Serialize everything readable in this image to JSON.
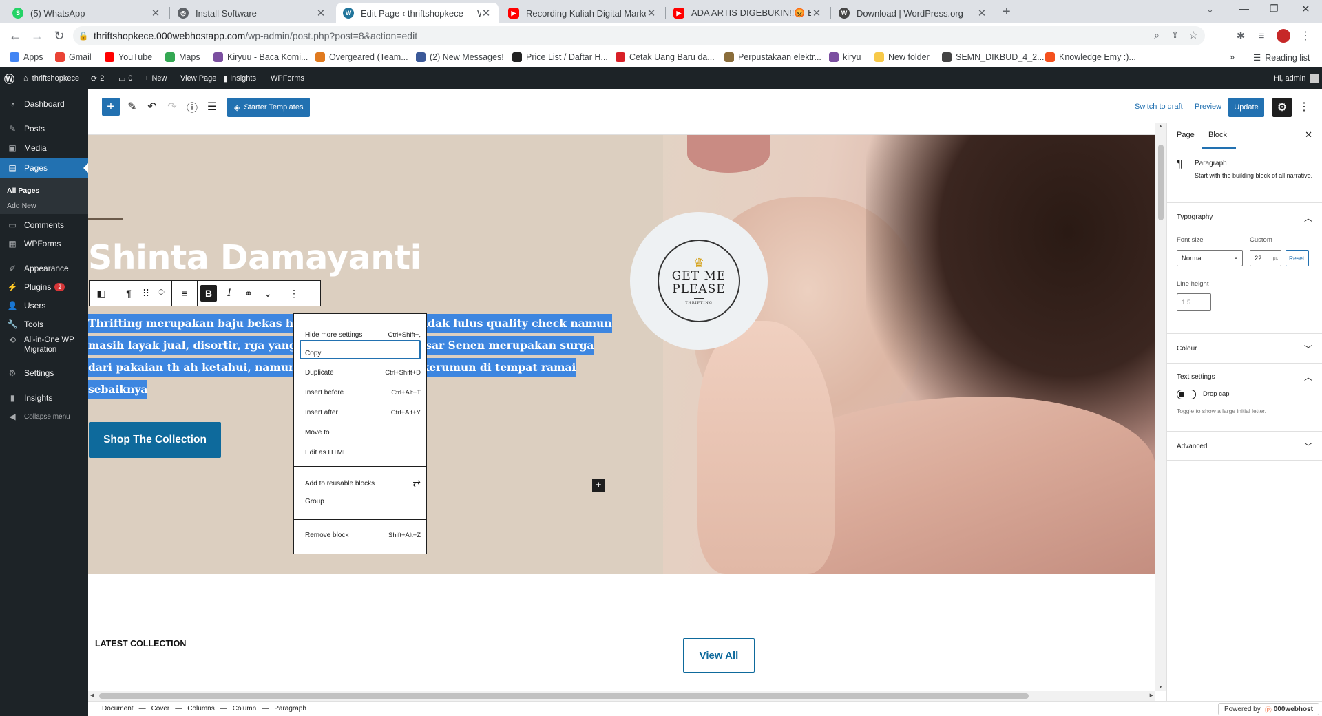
{
  "browser": {
    "tabs": [
      {
        "title": "(5) WhatsApp",
        "icon": "whatsapp-icon",
        "color": "#25d366"
      },
      {
        "title": "Install Software",
        "icon": "globe-icon",
        "color": "#5f6368"
      },
      {
        "title": "Edit Page ‹ thriftshopkece — Wo",
        "icon": "wordpress-icon",
        "color": "#21759b"
      },
      {
        "title": "Recording Kuliah Digital Marketin",
        "icon": "youtube-icon",
        "color": "#ff0000"
      },
      {
        "title": "ADA ARTIS DIGEBUKIN!!😡 ERICK",
        "icon": "youtube-icon",
        "color": "#ff0000"
      },
      {
        "title": "Download | WordPress.org",
        "icon": "wordpress-icon",
        "color": "#464646"
      }
    ],
    "url_host": "thriftshopkece.000webhostapp.com",
    "url_path": "/wp-admin/post.php?post=8&action=edit",
    "bookmarks": [
      {
        "label": "Apps",
        "color": "#4285f4"
      },
      {
        "label": "Gmail",
        "color": "#ea4335"
      },
      {
        "label": "YouTube",
        "color": "#ff0000"
      },
      {
        "label": "Maps",
        "color": "#34a853"
      },
      {
        "label": "Kiryuu - Baca Komi...",
        "color": "#7b4fa0"
      },
      {
        "label": "Overgeared (Team...",
        "color": "#e07a1f"
      },
      {
        "label": "(2) New Messages!",
        "color": "#3b5998"
      },
      {
        "label": "Price List / Daftar H...",
        "color": "#222222"
      },
      {
        "label": "Cetak Uang Baru da...",
        "color": "#d81f26"
      },
      {
        "label": "Perpustakaan elektr...",
        "color": "#8a6d3b"
      },
      {
        "label": "kiryu",
        "color": "#7b4fa0"
      },
      {
        "label": "New folder",
        "color": "#f7c948"
      },
      {
        "label": "SEMN_DIKBUD_4_2...",
        "color": "#444444"
      },
      {
        "label": "Knowledge Emy :)...",
        "color": "#f4511e"
      }
    ],
    "reading_list": "Reading list"
  },
  "adminbar": {
    "site": "thriftshopkece",
    "updates": "2",
    "comments": "0",
    "new": "New",
    "view_page": "View Page",
    "insights": "Insights",
    "wpforms": "WPForms",
    "greeting": "Hi, admin"
  },
  "menu": {
    "dashboard": "Dashboard",
    "posts": "Posts",
    "media": "Media",
    "pages": "Pages",
    "all_pages": "All Pages",
    "add_new": "Add New",
    "comments": "Comments",
    "wpforms": "WPForms",
    "appearance": "Appearance",
    "plugins": "Plugins",
    "plugins_badge": "2",
    "users": "Users",
    "tools": "Tools",
    "migration": "All-in-One WP Migration",
    "settings": "Settings",
    "insights": "Insights",
    "collapse": "Collapse menu"
  },
  "editor": {
    "starter_templates": "Starter Templates",
    "switch_to_draft": "Switch to draft",
    "preview": "Preview",
    "update": "Update"
  },
  "content": {
    "heading": "Shinta Damayanti",
    "paragraph": "Thrifting merupakan baju bekas hasil d      besarnya yang tidak lulus quality check namun masih layak jual, disortir,      rga yang jauh lebih murah. Pasar Senen merupakan surga dari pakaian th      ah ketahui, namun dimasa pandemi berkerumun di tempat ramai sebaiknya",
    "logo_line1": "GET ME",
    "logo_line2": "PLEASE",
    "logo_sub": "THRIFTING",
    "shop_button": "Shop The Collection",
    "latest": "LATEST COLLECTION",
    "view_all": "View All"
  },
  "dropdown": {
    "items": [
      {
        "label": "Hide more settings",
        "shortcut": "Ctrl+Shift+,"
      },
      {
        "label": "Copy",
        "shortcut": ""
      },
      {
        "label": "Duplicate",
        "shortcut": "Ctrl+Shift+D"
      },
      {
        "label": "Insert before",
        "shortcut": "Ctrl+Alt+T"
      },
      {
        "label": "Insert after",
        "shortcut": "Ctrl+Alt+Y"
      },
      {
        "label": "Move to",
        "shortcut": ""
      },
      {
        "label": "Edit as HTML",
        "shortcut": ""
      },
      {
        "label": "Add to reusable blocks",
        "shortcut": ""
      },
      {
        "label": "Group",
        "shortcut": ""
      },
      {
        "label": "Remove block",
        "shortcut": "Shift+Alt+Z"
      }
    ]
  },
  "sidebar": {
    "tab_page": "Page",
    "tab_block": "Block",
    "block_name": "Paragraph",
    "block_desc": "Start with the building block of all narrative.",
    "typography": "Typography",
    "font_size_label": "Font size",
    "custom_label": "Custom",
    "font_size_value": "Normal",
    "custom_value": "22",
    "custom_unit": "px",
    "reset": "Reset",
    "line_height_label": "Line height",
    "line_height_value": "1.5",
    "colour": "Colour",
    "text_settings": "Text settings",
    "drop_cap": "Drop cap",
    "drop_cap_help": "Toggle to show a large initial letter.",
    "advanced": "Advanced"
  },
  "breadcrumb": [
    "Document",
    "Cover",
    "Columns",
    "Column",
    "Paragraph"
  ],
  "powered_by": "Powered by",
  "powered_brand": "000webhost"
}
